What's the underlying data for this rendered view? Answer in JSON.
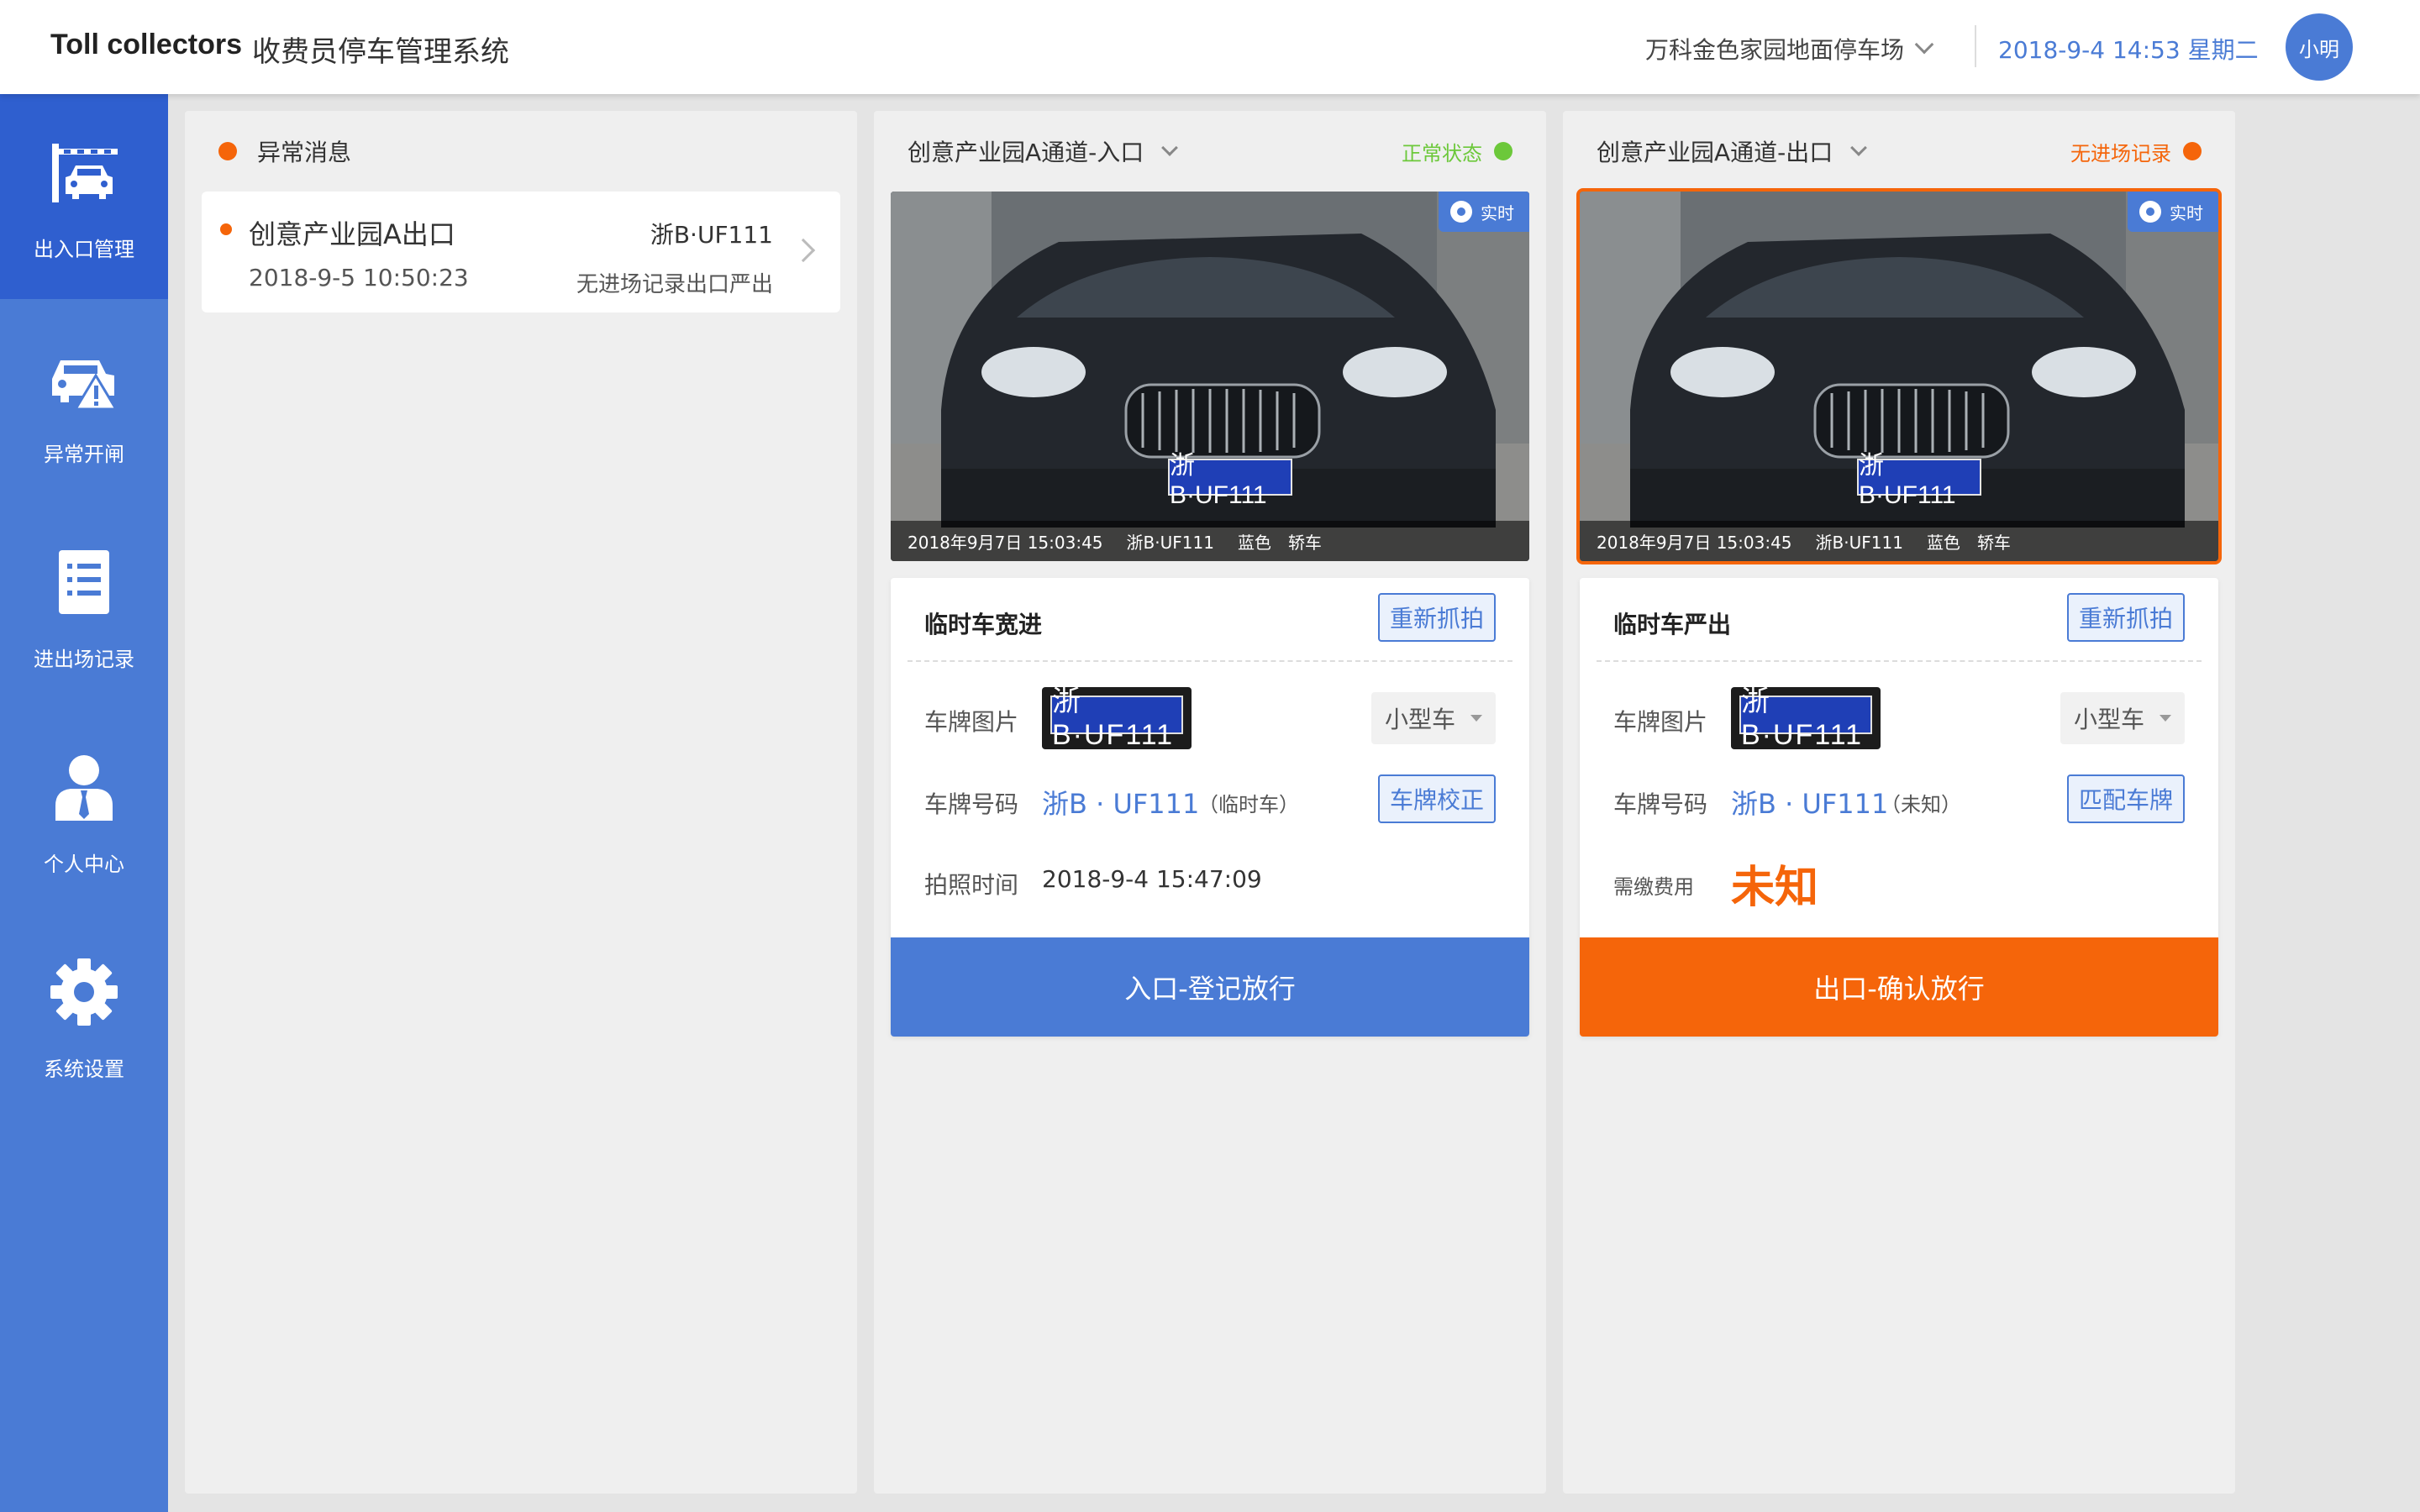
{
  "header": {
    "brand": "Toll collectors",
    "title": "收费员停车管理系统",
    "lot": "万科金色家园地面停车场",
    "datetime": "2018-9-4 14:53 星期二",
    "user": "小明"
  },
  "sidebar": {
    "items": [
      {
        "label": "出入口管理",
        "icon": "gate-car-icon",
        "active": true
      },
      {
        "label": "异常开闸",
        "icon": "car-warning-icon",
        "active": false
      },
      {
        "label": "进出场记录",
        "icon": "list-icon",
        "active": false
      },
      {
        "label": "个人中心",
        "icon": "user-icon",
        "active": false
      },
      {
        "label": "系统设置",
        "icon": "gear-icon",
        "active": false
      }
    ]
  },
  "messages": {
    "title": "异常消息",
    "items": [
      {
        "location": "创意产业园A出口",
        "plate": "浙B·UF111",
        "time": "2018-9-5 10:50:23",
        "desc": "无进场记录出口严出"
      }
    ]
  },
  "entry": {
    "lane": "创意产业园A通道-入口",
    "status": "正常状态",
    "camera_badge": "实时",
    "caption": {
      "time": "2018年9月7日 15:03:45",
      "plate": "浙B·UF111",
      "color": "蓝色",
      "type": "轿车"
    },
    "plate_on_car": "浙B·UF111",
    "card_title": "临时车宽进",
    "recapture": "重新抓拍",
    "label_plate_img": "车牌图片",
    "plate_img_text": "浙B·UF111",
    "vehicle_type": "小型车",
    "label_plate_num": "车牌号码",
    "plate_num": "浙B · UF111",
    "plate_note": "（临时车）",
    "correct_btn": "车牌校正",
    "label_time": "拍照时间",
    "photo_time": "2018-9-4 15:47:09",
    "action": "入口-登记放行"
  },
  "exit": {
    "lane": "创意产业园A通道-出口",
    "status": "无进场记录",
    "camera_badge": "实时",
    "caption": {
      "time": "2018年9月7日 15:03:45",
      "plate": "浙B·UF111",
      "color": "蓝色",
      "type": "轿车"
    },
    "plate_on_car": "浙B·UF111",
    "card_title": "临时车严出",
    "recapture": "重新抓拍",
    "label_plate_img": "车牌图片",
    "plate_img_text": "浙B·UF111",
    "vehicle_type": "小型车",
    "label_plate_num": "车牌号码",
    "plate_num": "浙B · UF111",
    "plate_note": "（未知）",
    "match_btn": "匹配车牌",
    "label_fee": "需缴费用",
    "fee": "未知",
    "action": "出口-确认放行"
  },
  "colors": {
    "primary": "#4a7bd5",
    "primary_dark": "#2f5fcf",
    "accent": "#f5650a",
    "ok": "#6cc83a"
  }
}
